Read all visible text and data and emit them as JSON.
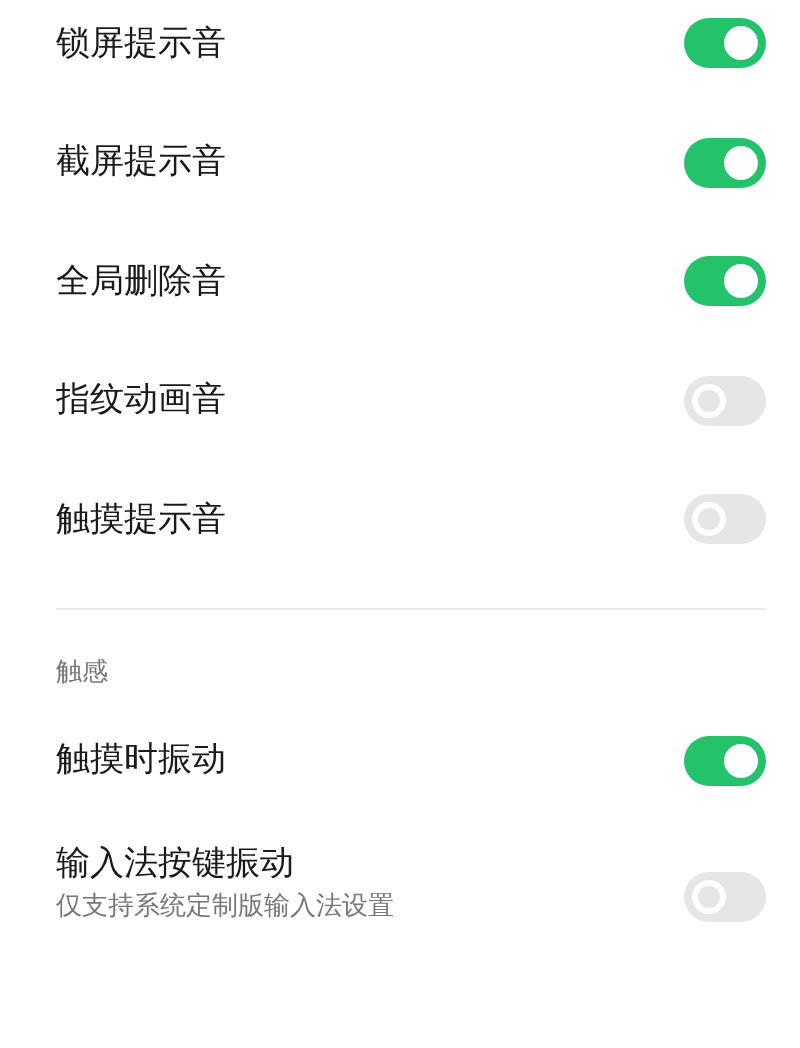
{
  "sections": [
    {
      "items": [
        {
          "title": "锁屏提示音",
          "on": true
        },
        {
          "title": "截屏提示音",
          "on": true
        },
        {
          "title": "全局删除音",
          "on": true
        },
        {
          "title": "指纹动画音",
          "on": false
        },
        {
          "title": "触摸提示音",
          "on": false
        }
      ]
    },
    {
      "header": "触感",
      "items": [
        {
          "title": "触摸时振动",
          "on": true
        },
        {
          "title": "输入法按键振动",
          "subtitle": "仅支持系统定制版输入法设置",
          "on": false
        }
      ]
    }
  ]
}
